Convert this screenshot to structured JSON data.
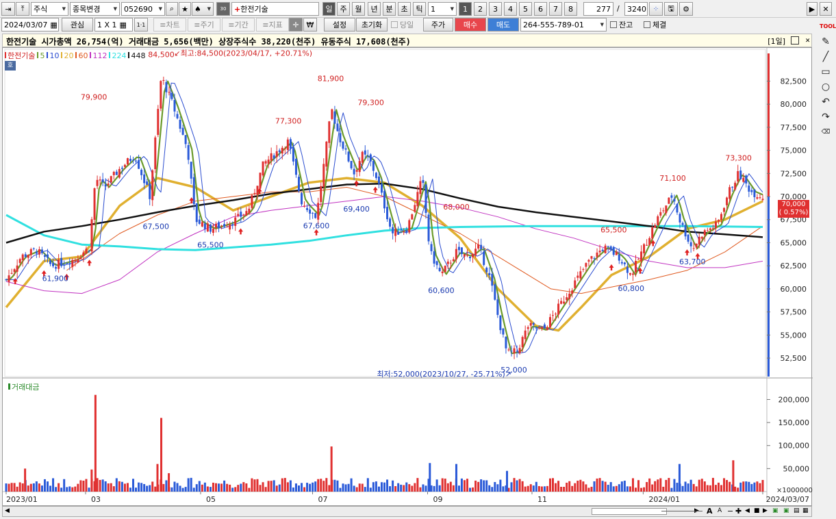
{
  "toolbar1": {
    "market": "주식",
    "change_label": "종목변경",
    "code": "052690",
    "stock_name": "한전기술",
    "tabs": [
      "일",
      "주",
      "월",
      "년",
      "분",
      "초",
      "틱"
    ],
    "period_value": "1",
    "nums": [
      "1",
      "2",
      "3",
      "4",
      "5",
      "6",
      "7",
      "8"
    ],
    "count": "277",
    "slash": "/",
    "total": "3240"
  },
  "toolbar2": {
    "date": "2024/03/07",
    "interest": "관심",
    "layout": "1 X 1",
    "one": "1·1",
    "chart_btn": "≡차트",
    "cycle": "≡주기",
    "period": "≡기간",
    "indicator": "≡지표",
    "won": "₩",
    "settings": "설정",
    "reset": "초기화",
    "today": "당일",
    "price": "주가",
    "buy": "매수",
    "sell": "매도",
    "account": "264-555-789-01",
    "balance": "잔고",
    "filled": "체결"
  },
  "infobar": {
    "text": "한전기술 시가총액 26,754(억) 거래대금 5,656(백만) 상장주식수 38,220(천주) 유동주식 17,608(천주)",
    "period_tag": "[1일]"
  },
  "price_legend": [
    {
      "label": "한전기술",
      "color": "#e03030"
    },
    {
      "label": "5",
      "color": "#6a9a2a"
    },
    {
      "label": "10",
      "color": "#2a4cd0"
    },
    {
      "label": "20",
      "color": "#e0b030"
    },
    {
      "label": "60",
      "color": "#e05a20"
    },
    {
      "label": "112",
      "color": "#c030c0"
    },
    {
      "label": "224",
      "color": "#30e0e0"
    },
    {
      "label": "448",
      "color": "#111111"
    }
  ],
  "ho": "호",
  "volume_legend": "거래대금",
  "high_note": "최고:84,500(2023/04/17, +20.71%)",
  "low_note": "최저:52,000(2023/10/27, -25.71%)",
  "current_price": "70,000",
  "current_change": "( 0.57%)",
  "volume_unit": "×1000000",
  "colors": {
    "up": "#e03030",
    "down": "#2a5ad8",
    "ma5": "#6a9a2a",
    "ma10": "#2a4cd0",
    "ma20": "#e0b030",
    "ma60": "#e05a20",
    "ma112": "#c030c0",
    "ma224": "#30e0e0",
    "ma448": "#111111"
  },
  "chart_data": [
    {
      "type": "candlestick",
      "title": "한전기술",
      "y_ticks": [
        "82,500",
        "80,000",
        "77,500",
        "75,000",
        "72,500",
        "70,000",
        "67,500",
        "65,000",
        "62,500",
        "60,000",
        "57,500",
        "55,000",
        "52,500"
      ],
      "y_values": [
        82500,
        80000,
        77500,
        75000,
        72500,
        70000,
        67500,
        65000,
        62500,
        60000,
        57500,
        55000,
        52500
      ],
      "ylim": [
        50500,
        85500
      ],
      "x_ticks": [
        "2023/01",
        "03",
        "05",
        "07",
        "09",
        "11",
        "2024/01",
        "2024/03/07"
      ],
      "peak_labels": [
        {
          "text": "79,900",
          "t": 0.116,
          "v": 79900,
          "kind": "high"
        },
        {
          "text": "84,500",
          "t": 0.205,
          "v": 84500,
          "kind": "high"
        },
        {
          "text": "77,300",
          "t": 0.373,
          "v": 77300,
          "kind": "high"
        },
        {
          "text": "81,900",
          "t": 0.429,
          "v": 81900,
          "kind": "high"
        },
        {
          "text": "79,300",
          "t": 0.482,
          "v": 79300,
          "kind": "high"
        },
        {
          "text": "68,000",
          "t": 0.595,
          "v": 68000,
          "kind": "high"
        },
        {
          "text": "65,500",
          "t": 0.803,
          "v": 65500,
          "kind": "high"
        },
        {
          "text": "71,100",
          "t": 0.881,
          "v": 71100,
          "kind": "high"
        },
        {
          "text": "73,300",
          "t": 0.968,
          "v": 73300,
          "kind": "high"
        },
        {
          "text": "61,900",
          "t": 0.065,
          "v": 61900,
          "kind": "low"
        },
        {
          "text": "67,500",
          "t": 0.198,
          "v": 67500,
          "kind": "low"
        },
        {
          "text": "65,500",
          "t": 0.27,
          "v": 65500,
          "kind": "low"
        },
        {
          "text": "67,600",
          "t": 0.41,
          "v": 67600,
          "kind": "low"
        },
        {
          "text": "69,400",
          "t": 0.463,
          "v": 69400,
          "kind": "low"
        },
        {
          "text": "60,600",
          "t": 0.575,
          "v": 60600,
          "kind": "low"
        },
        {
          "text": "52,000",
          "t": 0.671,
          "v": 52000,
          "kind": "low"
        },
        {
          "text": "60,800",
          "t": 0.826,
          "v": 60800,
          "kind": "low"
        },
        {
          "text": "63,700",
          "t": 0.907,
          "v": 63700,
          "kind": "low"
        }
      ],
      "price_path": [
        [
          0,
          61000
        ],
        [
          0.02,
          63500
        ],
        [
          0.04,
          64200
        ],
        [
          0.06,
          62500
        ],
        [
          0.09,
          63200
        ],
        [
          0.11,
          64500
        ],
        [
          0.118,
          72000
        ],
        [
          0.13,
          71000
        ],
        [
          0.15,
          73000
        ],
        [
          0.17,
          74500
        ],
        [
          0.19,
          70000
        ],
        [
          0.205,
          83000
        ],
        [
          0.22,
          80000
        ],
        [
          0.24,
          75000
        ],
        [
          0.25,
          67500
        ],
        [
          0.27,
          66500
        ],
        [
          0.3,
          67300
        ],
        [
          0.32,
          68500
        ],
        [
          0.34,
          73500
        ],
        [
          0.36,
          75000
        ],
        [
          0.373,
          76000
        ],
        [
          0.39,
          69500
        ],
        [
          0.41,
          67800
        ],
        [
          0.42,
          73500
        ],
        [
          0.43,
          79500
        ],
        [
          0.44,
          76500
        ],
        [
          0.46,
          72500
        ],
        [
          0.47,
          74500
        ],
        [
          0.48,
          74000
        ],
        [
          0.49,
          72000
        ],
        [
          0.51,
          66000
        ],
        [
          0.53,
          66500
        ],
        [
          0.55,
          72000
        ],
        [
          0.56,
          64000
        ],
        [
          0.575,
          61500
        ],
        [
          0.595,
          64000
        ],
        [
          0.61,
          63500
        ],
        [
          0.625,
          64500
        ],
        [
          0.64,
          61000
        ],
        [
          0.65,
          57000
        ],
        [
          0.662,
          53000
        ],
        [
          0.675,
          53200
        ],
        [
          0.69,
          56000
        ],
        [
          0.71,
          55500
        ],
        [
          0.73,
          58000
        ],
        [
          0.75,
          60500
        ],
        [
          0.77,
          63000
        ],
        [
          0.79,
          64500
        ],
        [
          0.81,
          63500
        ],
        [
          0.826,
          61500
        ],
        [
          0.84,
          64000
        ],
        [
          0.86,
          67500
        ],
        [
          0.881,
          70200
        ],
        [
          0.89,
          67500
        ],
        [
          0.907,
          64300
        ],
        [
          0.92,
          66000
        ],
        [
          0.94,
          67000
        ],
        [
          0.955,
          70500
        ],
        [
          0.968,
          72500
        ],
        [
          0.985,
          70500
        ],
        [
          1.0,
          70000
        ]
      ],
      "moving_averages": {
        "ma20": [
          [
            0,
            58000
          ],
          [
            0.05,
            63000
          ],
          [
            0.1,
            63500
          ],
          [
            0.15,
            69000
          ],
          [
            0.2,
            72000
          ],
          [
            0.25,
            71000
          ],
          [
            0.3,
            68500
          ],
          [
            0.35,
            70000
          ],
          [
            0.4,
            71500
          ],
          [
            0.45,
            72000
          ],
          [
            0.5,
            71500
          ],
          [
            0.55,
            69000
          ],
          [
            0.6,
            65500
          ],
          [
            0.65,
            60000
          ],
          [
            0.7,
            56000
          ],
          [
            0.73,
            55500
          ],
          [
            0.76,
            58000
          ],
          [
            0.8,
            61500
          ],
          [
            0.85,
            63500
          ],
          [
            0.9,
            66500
          ],
          [
            0.95,
            67500
          ],
          [
            1.0,
            69500
          ]
        ],
        "ma60": [
          [
            0.08,
            62000
          ],
          [
            0.15,
            66000
          ],
          [
            0.2,
            68000
          ],
          [
            0.25,
            69500
          ],
          [
            0.3,
            70000
          ],
          [
            0.35,
            70500
          ],
          [
            0.4,
            70500
          ],
          [
            0.45,
            71000
          ],
          [
            0.5,
            70000
          ],
          [
            0.55,
            68000
          ],
          [
            0.6,
            66000
          ],
          [
            0.65,
            63500
          ],
          [
            0.7,
            61000
          ],
          [
            0.72,
            60000
          ],
          [
            0.76,
            59500
          ],
          [
            0.8,
            60200
          ],
          [
            0.85,
            61000
          ],
          [
            0.9,
            62000
          ],
          [
            0.95,
            64000
          ],
          [
            1.0,
            66800
          ]
        ],
        "ma112": [
          [
            0,
            60800
          ],
          [
            0.05,
            59800
          ],
          [
            0.1,
            59500
          ],
          [
            0.15,
            61000
          ],
          [
            0.2,
            64000
          ],
          [
            0.25,
            66000
          ],
          [
            0.3,
            67800
          ],
          [
            0.35,
            68500
          ],
          [
            0.4,
            69000
          ],
          [
            0.45,
            69500
          ],
          [
            0.5,
            70000
          ],
          [
            0.55,
            69500
          ],
          [
            0.6,
            68800
          ],
          [
            0.65,
            67800
          ],
          [
            0.7,
            66500
          ],
          [
            0.75,
            65500
          ],
          [
            0.8,
            64200
          ],
          [
            0.85,
            63000
          ],
          [
            0.9,
            62300
          ],
          [
            0.95,
            62300
          ],
          [
            1.0,
            63000
          ]
        ],
        "ma224": [
          [
            0,
            68000
          ],
          [
            0.05,
            65800
          ],
          [
            0.1,
            64800
          ],
          [
            0.15,
            64600
          ],
          [
            0.2,
            64300
          ],
          [
            0.25,
            64200
          ],
          [
            0.3,
            64500
          ],
          [
            0.35,
            64800
          ],
          [
            0.4,
            65200
          ],
          [
            0.45,
            65800
          ],
          [
            0.5,
            66300
          ],
          [
            0.55,
            66600
          ],
          [
            0.6,
            66700
          ],
          [
            0.7,
            66800
          ],
          [
            0.8,
            66800
          ],
          [
            0.9,
            66800
          ],
          [
            1.0,
            66700
          ]
        ],
        "ma448": [
          [
            0,
            65000
          ],
          [
            0.05,
            66200
          ],
          [
            0.1,
            66800
          ],
          [
            0.15,
            67500
          ],
          [
            0.2,
            68300
          ],
          [
            0.25,
            69000
          ],
          [
            0.3,
            69600
          ],
          [
            0.35,
            70300
          ],
          [
            0.4,
            70800
          ],
          [
            0.45,
            71300
          ],
          [
            0.5,
            71400
          ],
          [
            0.55,
            70800
          ],
          [
            0.6,
            69800
          ],
          [
            0.65,
            68900
          ],
          [
            0.7,
            68300
          ],
          [
            0.75,
            67800
          ],
          [
            0.8,
            67300
          ],
          [
            0.85,
            66800
          ],
          [
            0.9,
            66200
          ],
          [
            0.95,
            65900
          ],
          [
            1.0,
            65600
          ]
        ]
      },
      "buy_arrows": [
        0.012,
        0.05,
        0.08,
        0.11,
        0.245,
        0.31,
        0.335,
        0.41,
        0.463,
        0.488,
        0.8,
        0.838,
        0.855,
        0.9,
        0.914
      ]
    },
    {
      "type": "bar",
      "title": "거래대금",
      "y_ticks": [
        "200,000",
        "150,000",
        "100,000",
        "50,000"
      ],
      "y_values": [
        200000,
        150000,
        100000,
        50000
      ],
      "ylim": [
        0,
        220000
      ],
      "spikes": [
        {
          "t": 0.025,
          "v": 50000,
          "dir": "up"
        },
        {
          "t": 0.118,
          "v": 210000,
          "dir": "up"
        },
        {
          "t": 0.113,
          "v": 48000,
          "dir": "up"
        },
        {
          "t": 0.205,
          "v": 160000,
          "dir": "up"
        },
        {
          "t": 0.2,
          "v": 60000,
          "dir": "up"
        },
        {
          "t": 0.215,
          "v": 40000,
          "dir": "up"
        },
        {
          "t": 0.43,
          "v": 98000,
          "dir": "up"
        },
        {
          "t": 0.56,
          "v": 62000,
          "dir": "down"
        },
        {
          "t": 0.595,
          "v": 60000,
          "dir": "down"
        },
        {
          "t": 0.662,
          "v": 45000,
          "dir": "down"
        },
        {
          "t": 0.89,
          "v": 60000,
          "dir": "down"
        },
        {
          "t": 0.961,
          "v": 68000,
          "dir": "up"
        }
      ]
    }
  ]
}
